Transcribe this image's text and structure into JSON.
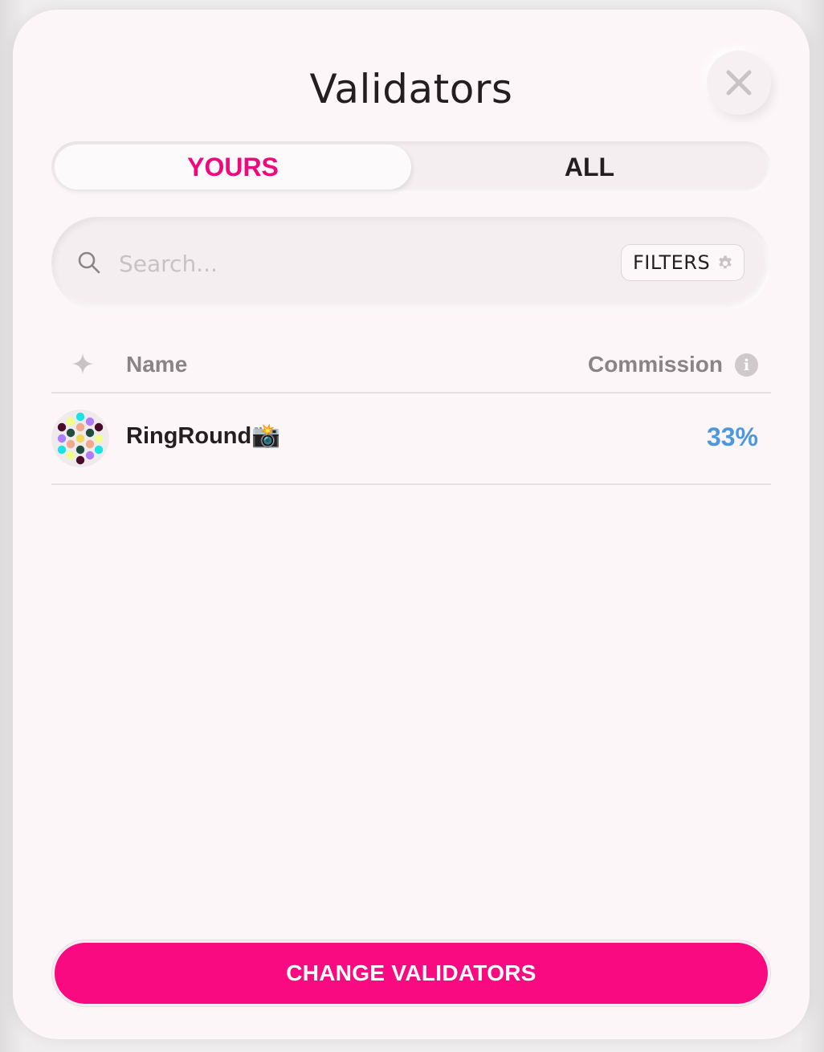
{
  "modal": {
    "title": "Validators",
    "close_icon": "close-icon"
  },
  "tabs": [
    {
      "label": "YOURS",
      "active": true
    },
    {
      "label": "ALL",
      "active": false
    }
  ],
  "search": {
    "placeholder": "Search...",
    "value": "",
    "filters_label": "FILTERS",
    "icons": [
      "search-icon",
      "gear-icon"
    ]
  },
  "table": {
    "columns": {
      "name": "Name",
      "commission": "Commission"
    },
    "rows": [
      {
        "name": "RingRound📸",
        "commission": "33%"
      }
    ]
  },
  "footer": {
    "change_button_label": "CHANGE VALIDATORS"
  },
  "colors": {
    "accent": "#f90a80",
    "active_tab": "#f1077e",
    "commission": "#4b97e0",
    "background": "#fcf6f9"
  }
}
